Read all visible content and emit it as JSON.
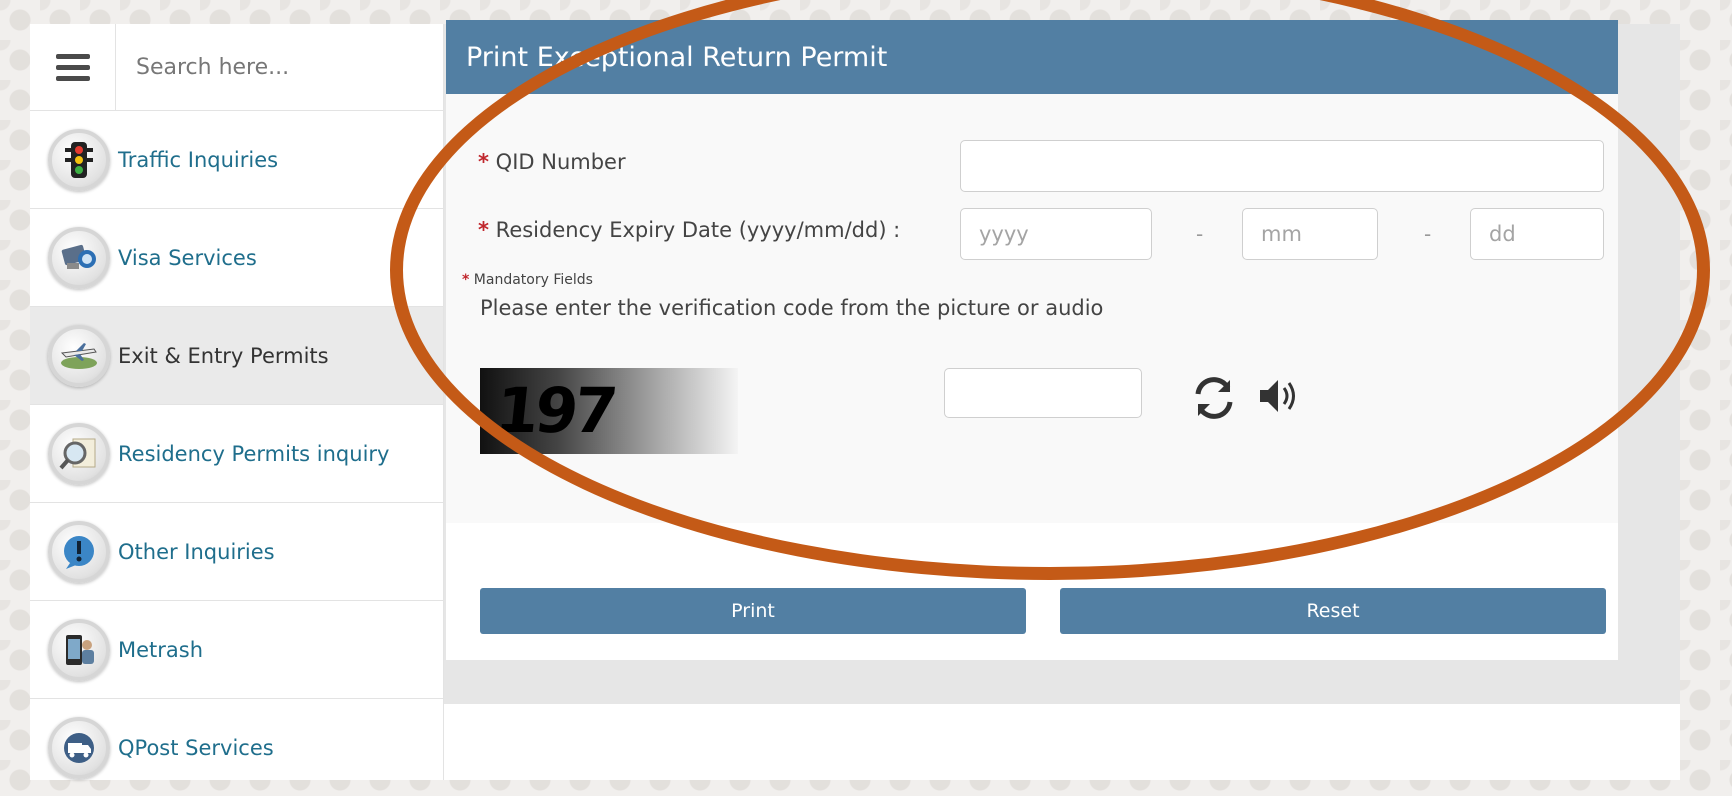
{
  "search": {
    "placeholder": "Search here..."
  },
  "sidebar": {
    "items": [
      {
        "label": "Traffic Inquiries",
        "icon": "traffic-light-icon"
      },
      {
        "label": "Visa Services",
        "icon": "passport-icon"
      },
      {
        "label": "Exit & Entry Permits",
        "icon": "airplane-icon",
        "active": true
      },
      {
        "label": "Residency Permits inquiry",
        "icon": "magnifier-document-icon"
      },
      {
        "label": "Other Inquiries",
        "icon": "info-icon"
      },
      {
        "label": "Metrash",
        "icon": "mobile-phone-icon"
      },
      {
        "label": "QPost Services",
        "icon": "delivery-truck-icon"
      }
    ]
  },
  "form": {
    "title": "Print Exceptional Return Permit",
    "qid_label": "QID Number",
    "qid_value": "",
    "residency_label": "Residency Expiry Date (yyyy/mm/dd) :",
    "yyyy_placeholder": "yyyy",
    "mm_placeholder": "mm",
    "dd_placeholder": "dd",
    "separator": "-",
    "required_marker": "*",
    "mandatory_note": "Mandatory Fields",
    "verification_text": "Please enter the verification code from the picture or audio",
    "captcha_text": "197",
    "captcha_value": "",
    "print_label": "Print",
    "reset_label": "Reset"
  },
  "colors": {
    "header": "#527fa3",
    "button": "#527fa3",
    "sidebar_link": "#1f6e8c",
    "required": "#c0272d",
    "annotation_ellipse": "#c45a17"
  }
}
